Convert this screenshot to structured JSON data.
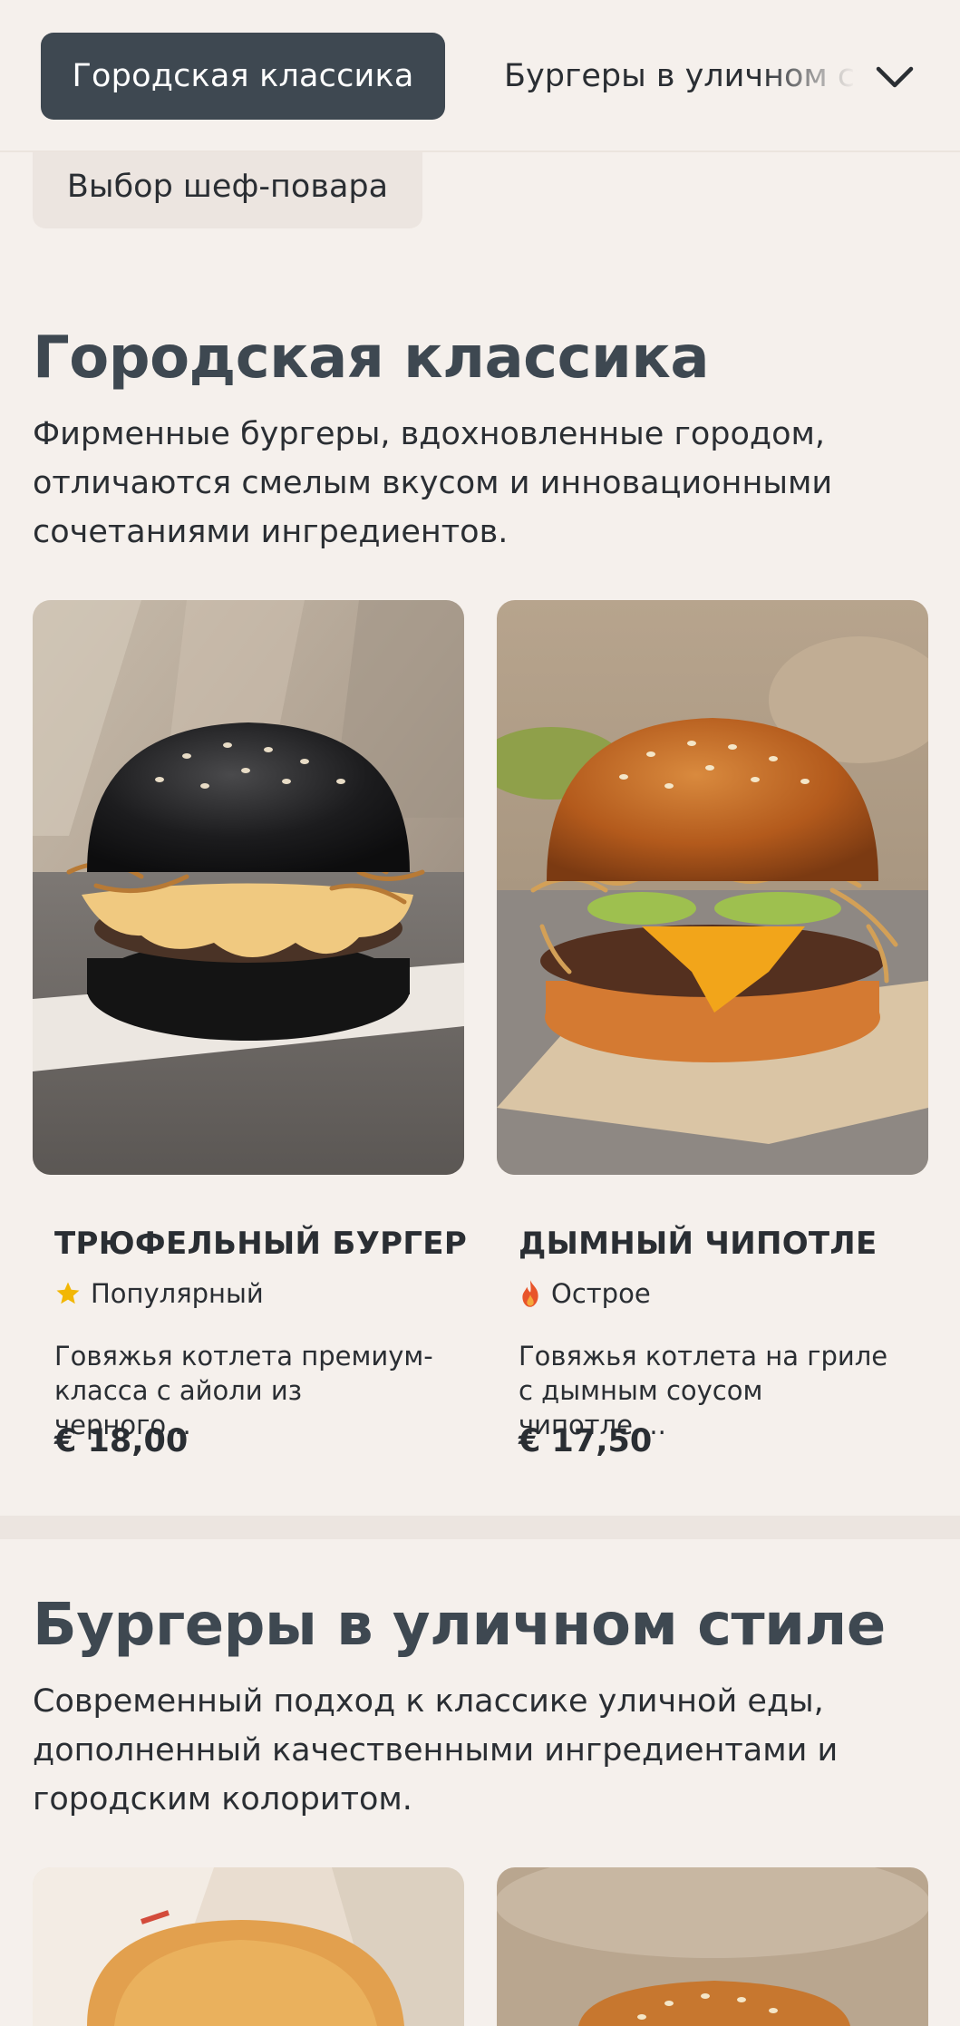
{
  "nav": {
    "active_tab": "Городская классика",
    "next_tab": "Бургеры в уличном стиле",
    "chef_chip": "Выбор шеф-повара"
  },
  "sections": [
    {
      "title": "Городская классика",
      "description": "Фирменные бургеры, вдохновленные городом, отличаются смелым вкусом и инновационными сочетаниями ингредиентов.",
      "items": [
        {
          "name": "ТРЮФЕЛЬНЫЙ БУРГЕР",
          "tag": "Популярный",
          "tag_icon": "star-icon",
          "description": "Говяжья котлета премиум-класса с айоли из черного...",
          "price": "€ 18,00"
        },
        {
          "name": "ДЫМНЫЙ ЧИПОТЛЕ",
          "tag": "Острое",
          "tag_icon": "fire-icon",
          "description": "Говяжья котлета на гриле с дымным соусом чипотле,...",
          "price": "€ 17,50"
        }
      ]
    },
    {
      "title": "Бургеры в уличном стиле",
      "description": "Современный подход к классике уличной еды, дополненный качественными ингредиентами и городским колоритом."
    }
  ],
  "colors": {
    "background": "#f5f0ec",
    "active_tab": "#3e4851",
    "heading": "#3e4851",
    "star": "#f2b705",
    "fire": "#e8542a"
  }
}
